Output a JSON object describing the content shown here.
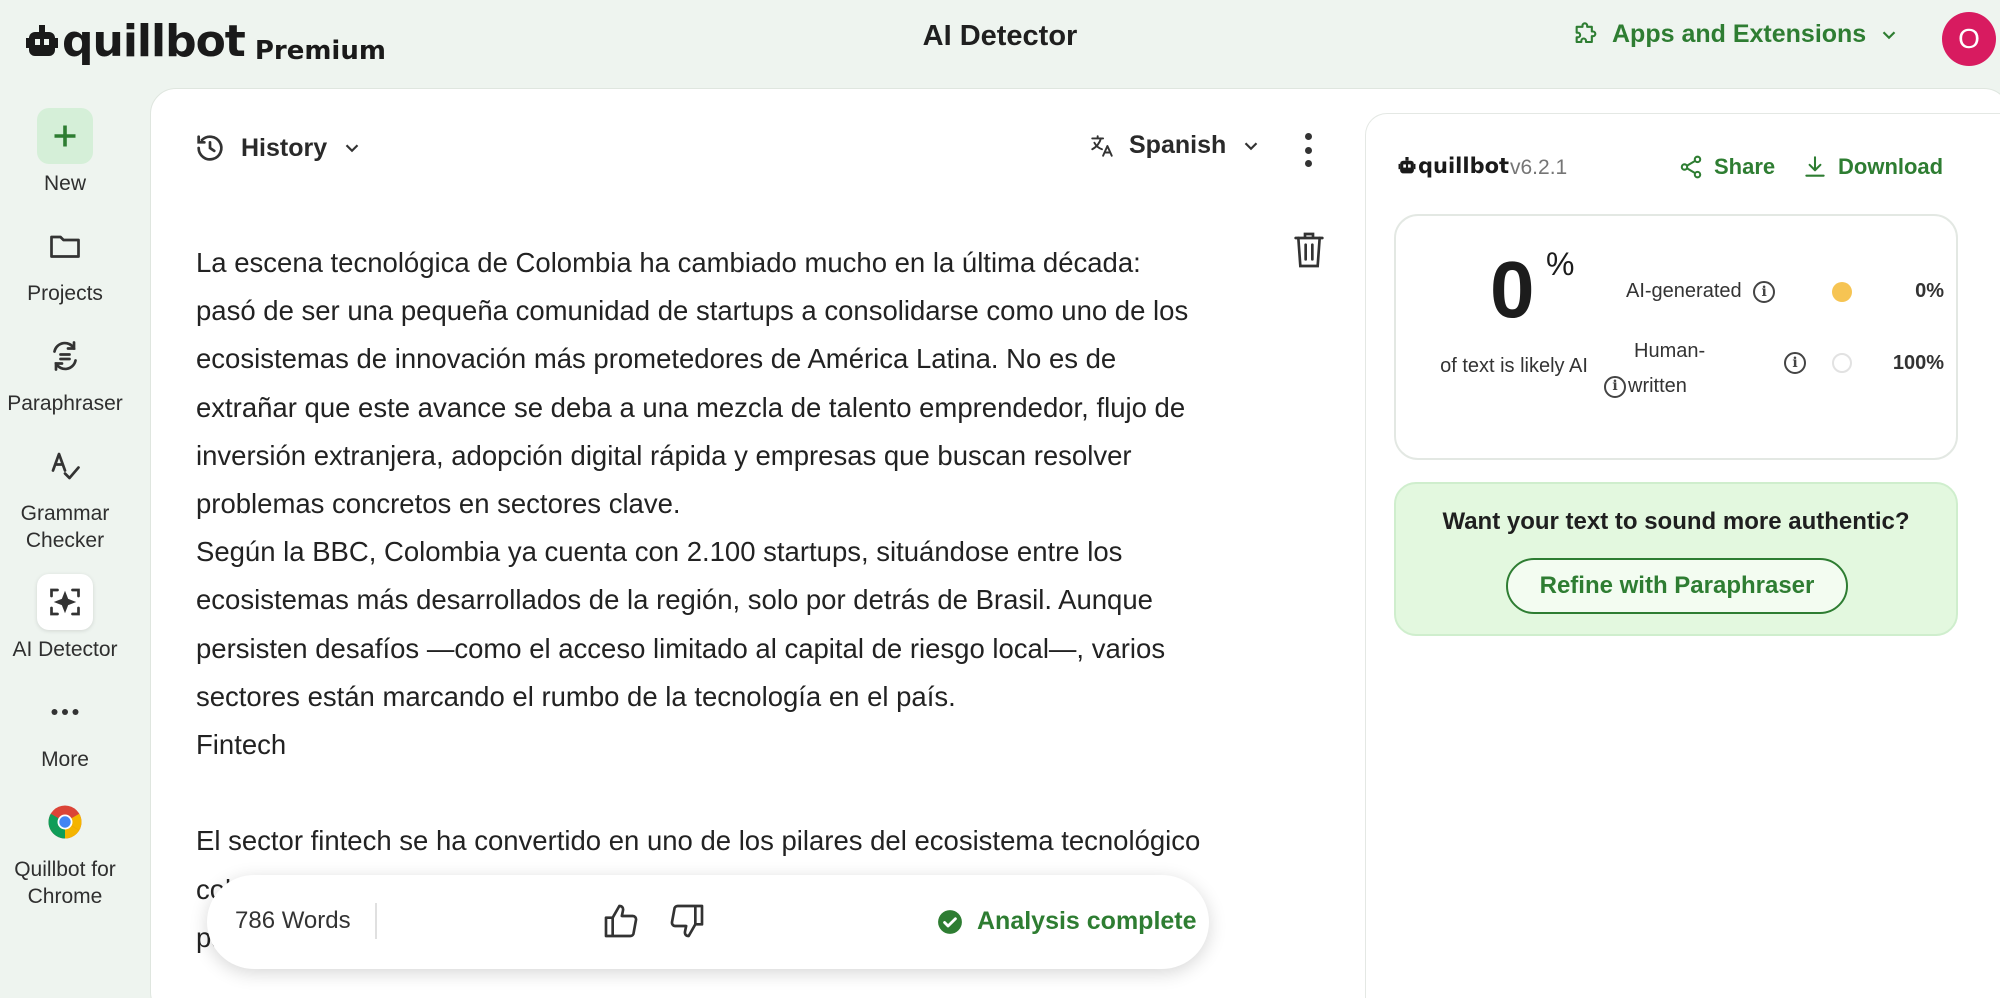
{
  "header": {
    "logo_text": "quillbot",
    "plan": "Premium",
    "title": "AI Detector",
    "apps_label": "Apps and Extensions",
    "avatar_initial": "O"
  },
  "sidebar": {
    "items": [
      {
        "label": "New",
        "icon": "plus-icon"
      },
      {
        "label": "Projects",
        "icon": "folder-icon"
      },
      {
        "label": "Paraphraser",
        "icon": "paraphraser-icon"
      },
      {
        "label": "Grammar Checker",
        "icon": "grammar-icon"
      },
      {
        "label": "AI Detector",
        "icon": "ai-detector-icon"
      },
      {
        "label": "More",
        "icon": "more-dots-icon"
      },
      {
        "label": "Quillbot for Chrome",
        "icon": "chrome-icon"
      }
    ]
  },
  "editor": {
    "history_label": "History",
    "language_label": "Spanish",
    "paragraphs": [
      "La escena tecnológica de Colombia ha cambiado mucho en la última década: pasó de ser una pequeña comunidad de startups a consolidarse como uno de los ecosistemas de innovación más prometedores de América Latina. No es de extrañar que este avance se deba a una mezcla de talento emprendedor, flujo de inversión extranjera, adopción digital rápida y empresas que buscan resolver problemas concretos en sectores clave.",
      "Según la BBC, Colombia ya cuenta con 2.100 startups, situándose entre los ecosistemas más desarrollados de la región, solo por detrás de Brasil. Aunque persisten desafíos —como el acceso limitado al capital de riesgo local—, varios sectores están marcando el rumbo de la tecnología en el país.",
      "Fintech",
      "",
      "El sector fintech se ha convertido en uno de los pilares del ecosistema tecnológico colombiano. Millones de personas y pequeños comercios enfrentan dificultades para acceder a la banca tradicional, lo que ha alimentado la"
    ],
    "word_count": "786 Words",
    "status": "Analysis complete"
  },
  "results": {
    "logo_text": "quillbot",
    "version": "v6.2.1",
    "share_label": "Share",
    "download_label": "Download",
    "score_value": "0",
    "score_unit": "%",
    "score_caption": "of text is likely AI",
    "rows": [
      {
        "label": "AI-generated",
        "value": "0%",
        "color": "#f6c453"
      },
      {
        "label": "Human-written",
        "label_line1": "Human-",
        "label_line2": "written",
        "value": "100%",
        "color": "#ffffff"
      }
    ],
    "refine_question": "Want your text to sound more authentic?",
    "refine_button": "Refine with Paraphraser"
  },
  "colors": {
    "accent_green": "#2e7d32",
    "background": "#eef4ef",
    "avatar": "#d81b60",
    "refine_bg": "#e3f8df"
  }
}
